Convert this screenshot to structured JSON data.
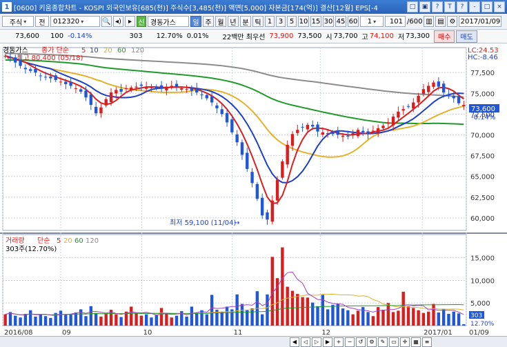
{
  "window": {
    "icon": "1",
    "title": "[0600] 키움종합차트 - KOSPI 외국인보유[685(천)] 주식수[3,485(천)] 액면[5,000] 자본금[174(억)] 결산[12월] EPS[-4",
    "buttons": [
      "□",
      "▣",
      "?",
      "T",
      "?",
      "-",
      "□",
      "×"
    ]
  },
  "toolbar": {
    "market": "주식",
    "period_prev": "전",
    "code": "012320",
    "stock_tag": "신",
    "stock_name": "경동가스",
    "timeframes": [
      "일",
      "주",
      "월",
      "년",
      "분",
      "틱"
    ],
    "active_timeframe": "일",
    "intervals": [
      "1",
      "3",
      "5",
      "10",
      "15",
      "30",
      "45",
      "60"
    ],
    "unit_value": "1",
    "count": "101",
    "count_total": "/600",
    "date": "2017/01/09"
  },
  "quote": {
    "price": "73,600",
    "change": "100",
    "change_pct": "-0.14%",
    "volume": "303",
    "vol_ratio": "12.70%",
    "turnover": "0.01%",
    "brokers": "22백만 최우선",
    "ask": "73,900",
    "bid": "73,500",
    "open_label": "시",
    "open": "73,700",
    "high_label": "고",
    "high": "74,100",
    "low_label": "저",
    "low": "73,300",
    "buy": "매수",
    "sell": "매도"
  },
  "main_legend": {
    "name": "경동가스",
    "ma_title": "종가 단순",
    "ma": [
      "5",
      "10",
      "20",
      "60",
      "120"
    ],
    "high_note": "최고 80,400 (05/18)",
    "low_note": "최저 59,100 (11/04)",
    "lc": "LC:24.53",
    "hc": "HC:-8.46",
    "price_tag": "73,600",
    "pct_tag": "-0.14%"
  },
  "volume_legend": {
    "name": "거래량",
    "ma_title": "단순",
    "ma": [
      "5",
      "20",
      "60",
      "120"
    ],
    "current": "303주(12.70%)",
    "tag": "303",
    "tag_pct": "12.70%"
  },
  "colors": {
    "up": "#d81e1e",
    "down": "#1f57d8",
    "ma5": "#d81e1e",
    "ma10": "#1c3fc4",
    "ma20": "#e3b12a",
    "ma60": "#1f9a2a",
    "ma120": "#8c8c8c"
  },
  "chart_data": {
    "type": "candlestick",
    "x_ticks": [
      "2016/08",
      "09",
      "10",
      "11",
      "12",
      "2017/01",
      "01/09"
    ],
    "y_ticks": [
      60000,
      62500,
      65000,
      67500,
      70000,
      72500,
      75000,
      77500
    ],
    "y_range": [
      58500,
      80500
    ],
    "vol_ticks": [
      5000,
      10000,
      15000
    ],
    "vol_range": [
      0,
      18000
    ],
    "key_points": [
      {
        "label": "최고",
        "value": 80400,
        "date": "05/18"
      },
      {
        "label": "최저",
        "value": 59100,
        "date": "11/04"
      }
    ],
    "close": [
      79500,
      79200,
      78700,
      78300,
      77900,
      77700,
      77500,
      77100,
      76900,
      76800,
      76600,
      76400,
      76100,
      75900,
      75600,
      75200,
      74500,
      73600,
      72600,
      73300,
      74300,
      75100,
      75400,
      75200,
      75600,
      75700,
      75800,
      75900,
      75800,
      75700,
      75600,
      75600,
      75800,
      75900,
      75800,
      75600,
      75500,
      75300,
      75100,
      74800,
      74400,
      73900,
      73200,
      72500,
      71500,
      70300,
      69100,
      67600,
      65900,
      64200,
      62300,
      60300,
      59800,
      62100,
      64600,
      66800,
      68800,
      70100,
      70600,
      70900,
      71200,
      71000,
      70400,
      70300,
      70200,
      70100,
      70000,
      69900,
      69800,
      70200,
      70600,
      70300,
      70100,
      70500,
      70800,
      71100,
      71500,
      72200,
      72800,
      73100,
      73400,
      73900,
      74700,
      75500,
      75900,
      76300,
      75800,
      75100,
      74700,
      74400,
      73800,
      73600
    ],
    "volume": [
      2500,
      3000,
      2200,
      1800,
      2600,
      3400,
      2000,
      2500,
      2100,
      1700,
      2800,
      3300,
      2400,
      2600,
      2900,
      3600,
      2100,
      4300,
      2800,
      2000,
      2600,
      3500,
      2500,
      1900,
      3100,
      4200,
      2700,
      2200,
      2500,
      1800,
      2300,
      3900,
      2600,
      1800,
      2200,
      3200,
      2000,
      4200,
      2800,
      3400,
      2500,
      6800,
      3500,
      3100,
      4200,
      3600,
      6900,
      4800,
      3500,
      3800,
      7600,
      2500,
      6900,
      15200,
      10500,
      17300,
      8600,
      7700,
      7000,
      6300,
      6200,
      5100,
      4300,
      6800,
      3600,
      4600,
      4800,
      3800,
      3400,
      2500,
      3300,
      4100,
      3000,
      2100,
      4100,
      3500,
      5000,
      3000,
      3300,
      7500,
      4300,
      3900,
      3400,
      2800,
      3100,
      4800,
      2900,
      3600,
      2600,
      3100,
      2700,
      303
    ]
  }
}
